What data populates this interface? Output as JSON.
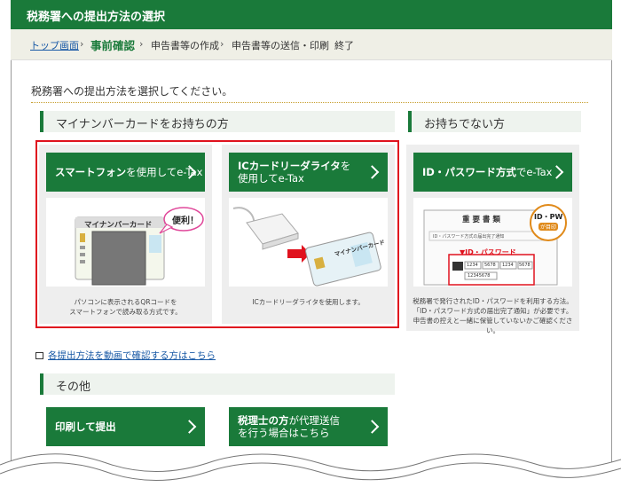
{
  "header": {
    "title": "税務署への提出方法の選択"
  },
  "breadcrumb": {
    "items": [
      {
        "label": "トップ画面"
      },
      {
        "label": "事前確認"
      },
      {
        "label": "申告書等の作成"
      },
      {
        "label": "申告書等の送信・印刷"
      },
      {
        "label": "終了"
      }
    ],
    "separator": "›"
  },
  "instruction": "税務署への提出方法を選択してください。",
  "sections": {
    "mynumber": {
      "title": "マイナンバーカードをお持ちの方"
    },
    "nocard": {
      "title": "お持ちでない方"
    },
    "other": {
      "title": "その他"
    }
  },
  "cards": {
    "smartphone": {
      "btn_a": "スマートフォン",
      "btn_b": "を使用してe-Tax",
      "illus_card_label": "マイナンバーカード",
      "illus_bubble": "便利！",
      "desc_1": "パソコンに表示されるQRコードを",
      "desc_2": "スマートフォンで読み取る方式です。"
    },
    "icreader": {
      "btn_a": "ICカードリーダライタ",
      "btn_b": "を",
      "btn_c": "使用してe-Tax",
      "illus_card_label": "マイナンバーカード",
      "desc_1": "ICカードリーダライタを使用します。"
    },
    "idpw": {
      "btn_a": "ID・パスワード方式",
      "btn_b": "でe-Tax",
      "illus_doc_title": "重 要 書 類",
      "illus_doc_sub": "ID・パスワード方式の届出完了通知",
      "illus_badge_1": "ID・PW",
      "illus_badge_2": "が目印",
      "illus_id_label": "▼ID・パスワード",
      "illus_id_values": [
        "1234",
        "5678",
        "1234",
        "5678"
      ],
      "illus_pw_value": "12345678",
      "desc_1": "税務署で発行されたID・パスワードを利用する方法。",
      "desc_2": "「ID・パスワード方式の届出完了通知」が必要です。",
      "desc_3": "申告書の控えと一緒に保管していないかご確認ください。"
    }
  },
  "video_link": {
    "label": "各提出方法を動画で確認する方はこちら"
  },
  "other_buttons": {
    "print": {
      "label": "印刷して提出"
    },
    "tax_accountant": {
      "label_a": "税理士の方",
      "label_b": "が代理送信",
      "label_c": "を行う場合はこちら"
    }
  },
  "colors": {
    "green": "#1a7a3a",
    "red_frame": "#e0121e",
    "link_blue": "#1a5aa6"
  }
}
